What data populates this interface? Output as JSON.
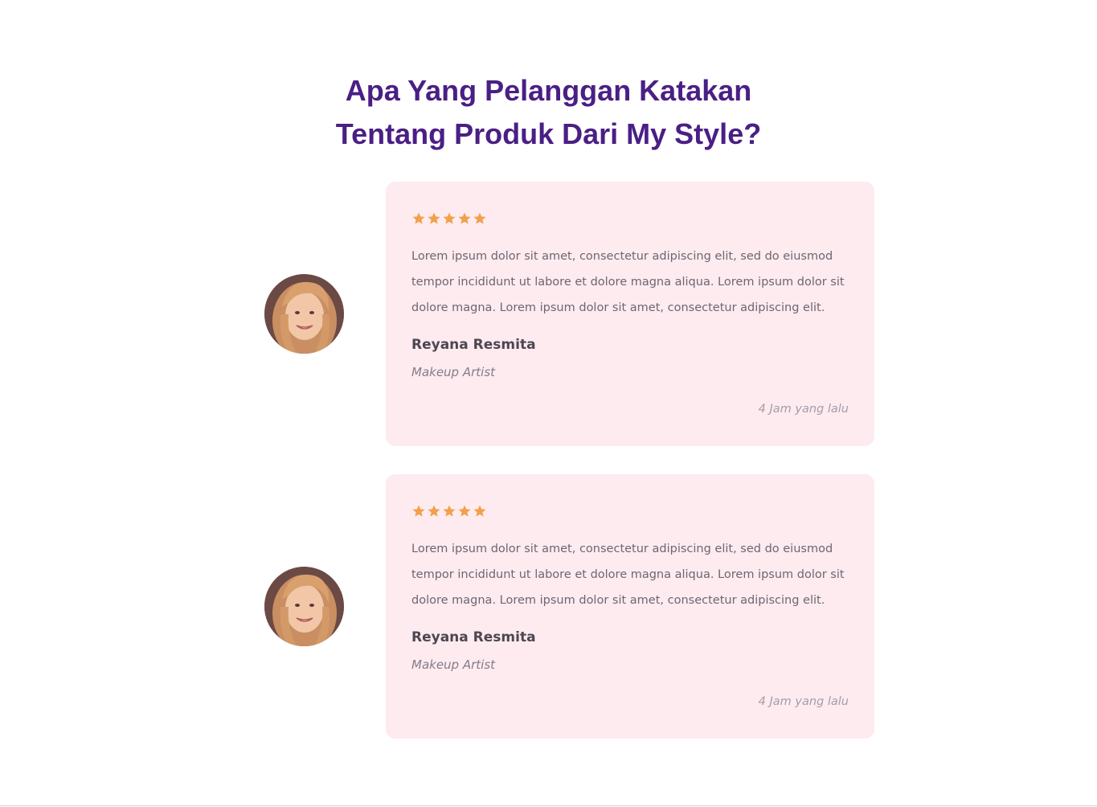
{
  "section": {
    "title_line1": "Apa Yang Pelanggan Katakan",
    "title_line2": "Tentang Produk Dari My Style?"
  },
  "colors": {
    "title": "#4a1f85",
    "card_background": "#fdebf0",
    "star": "#f2a04a"
  },
  "testimonials": [
    {
      "rating": 5,
      "quote": "Lorem ipsum dolor sit amet, consectetur adipiscing elit, sed do eiusmod tempor incididunt ut labore et dolore magna aliqua. Lorem ipsum dolor sit dolore magna. Lorem ipsum dolor sit amet, consectetur adipiscing elit.",
      "name": "Reyana Resmita",
      "role": "Makeup Artist",
      "time": "4 Jam yang lalu",
      "avatar_icon": "user-avatar"
    },
    {
      "rating": 5,
      "quote": "Lorem ipsum dolor sit amet, consectetur adipiscing elit, sed do eiusmod tempor incididunt ut labore et dolore magna aliqua. Lorem ipsum dolor sit dolore magna. Lorem ipsum dolor sit amet, consectetur adipiscing elit.",
      "name": "Reyana Resmita",
      "role": "Makeup Artist",
      "time": "4 Jam yang lalu",
      "avatar_icon": "user-avatar"
    }
  ]
}
